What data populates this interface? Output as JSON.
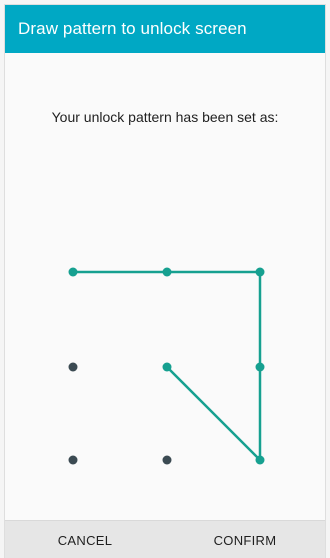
{
  "dialog": {
    "title": "Draw pattern to unlock screen",
    "message": "Your unlock pattern has been set as:"
  },
  "pattern": {
    "grid_size": 3,
    "sequence": [
      {
        "row": 0,
        "col": 0
      },
      {
        "row": 0,
        "col": 1
      },
      {
        "row": 0,
        "col": 2
      },
      {
        "row": 1,
        "col": 2
      },
      {
        "row": 2,
        "col": 2
      },
      {
        "row": 1,
        "col": 1
      }
    ],
    "active_color": "#16a090",
    "inactive_color": "#3b4a52"
  },
  "buttons": {
    "cancel_label": "CANCEL",
    "confirm_label": "CONFIRM"
  },
  "colors": {
    "title_bar": "#00a8c4",
    "background": "#fafafa"
  }
}
